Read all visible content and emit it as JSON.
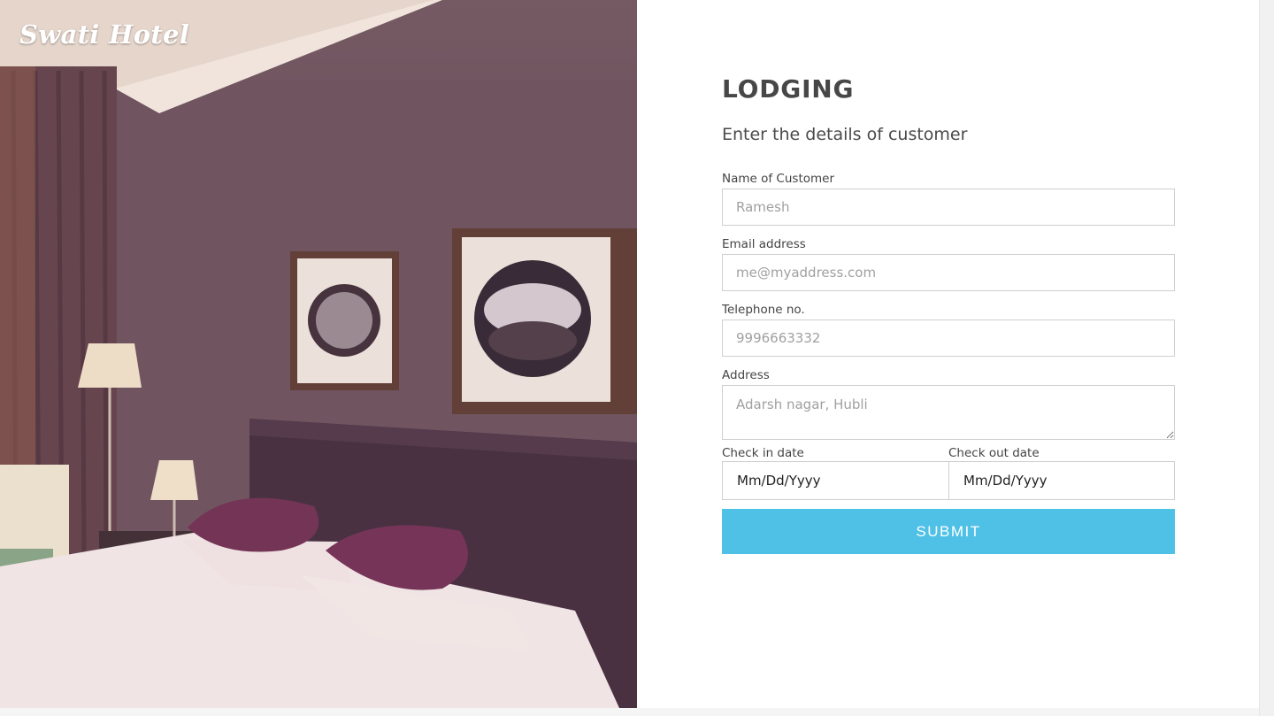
{
  "brand": {
    "name": "Swati Hotel"
  },
  "form": {
    "title": "LODGING",
    "subtitle": "Enter the details of customer",
    "name": {
      "label": "Name of Customer",
      "placeholder": "Ramesh"
    },
    "email": {
      "label": "Email address",
      "placeholder": "me@myaddress.com"
    },
    "phone": {
      "label": "Telephone no.",
      "placeholder": "9996663332"
    },
    "address": {
      "label": "Address",
      "placeholder": "Adarsh nagar, Hubli"
    },
    "checkin": {
      "label": "Check in date",
      "value": "Mm/Dd/Yyyy"
    },
    "checkout": {
      "label": "Check out date",
      "value": "Mm/Dd/Yyyy"
    },
    "submit_label": "SUBMIT"
  },
  "colors": {
    "accent": "#4fc0e6",
    "heading": "#474747",
    "border": "#cfcfcf"
  }
}
